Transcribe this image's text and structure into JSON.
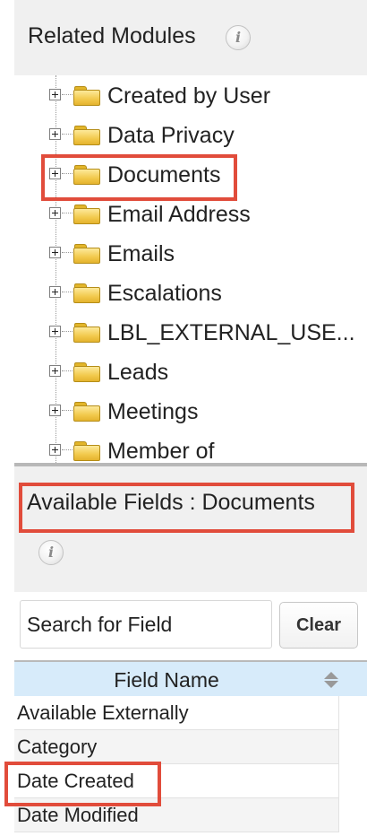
{
  "related_modules": {
    "title": "Related Modules",
    "info_icon": "info-icon",
    "items": [
      {
        "label": "Created by User"
      },
      {
        "label": "Data Privacy"
      },
      {
        "label": "Documents",
        "highlighted": true
      },
      {
        "label": "Email Address"
      },
      {
        "label": "Emails"
      },
      {
        "label": "Escalations"
      },
      {
        "label": "LBL_EXTERNAL_USE..."
      },
      {
        "label": "Leads"
      },
      {
        "label": "Meetings"
      },
      {
        "label": "Member of"
      }
    ]
  },
  "available_fields": {
    "title": "Available Fields : Documents",
    "info_icon": "info-icon",
    "search": {
      "placeholder": "Search for Field",
      "value": ""
    },
    "clear_label": "Clear",
    "table": {
      "column_header": "Field Name",
      "sort_icon": "sort-icon",
      "rows": [
        {
          "label": "Available Externally"
        },
        {
          "label": "Category"
        },
        {
          "label": "Date Created",
          "highlighted": true
        },
        {
          "label": "Date Modified"
        }
      ]
    }
  },
  "colors": {
    "highlight": "#e14c3b",
    "table_header": "#d7ebfa",
    "panel_bg": "#f0f0f0",
    "folder": "#f2c94c"
  }
}
